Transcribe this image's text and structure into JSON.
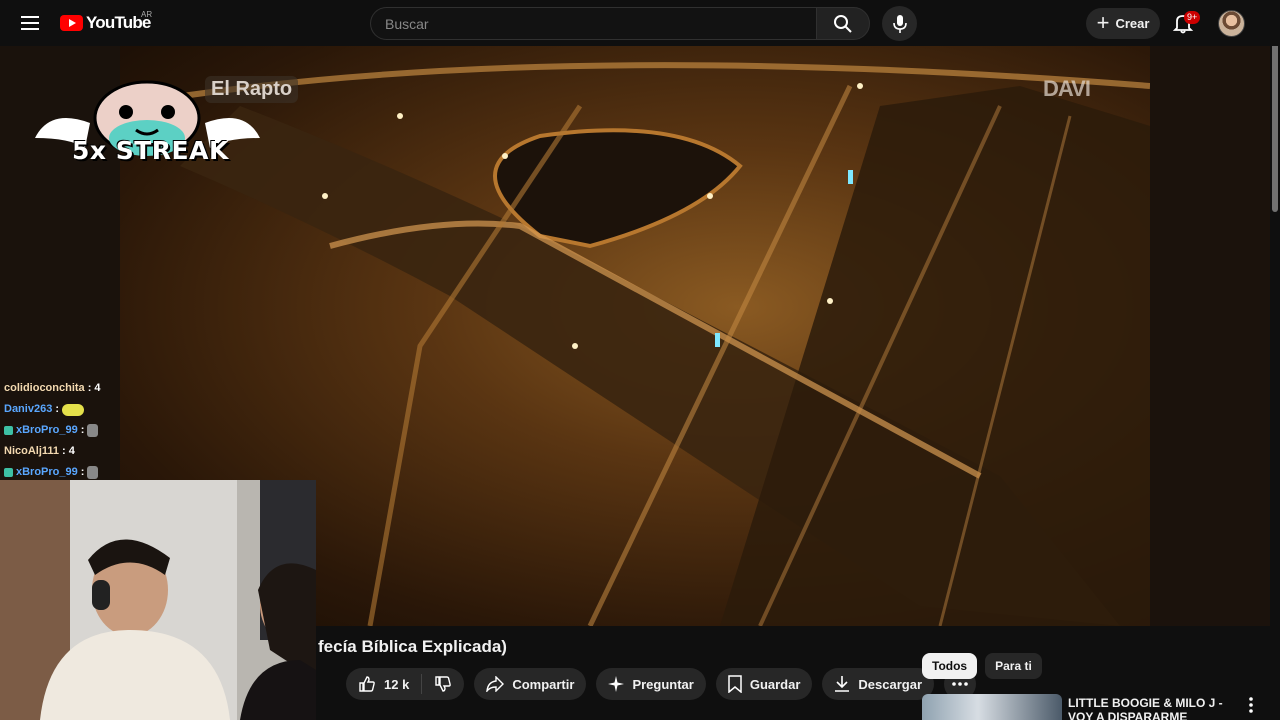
{
  "header": {
    "logo_text": "YouTube",
    "country_code": "AR",
    "search_placeholder": "Buscar",
    "create_label": "Crear",
    "notifications_badge": "9+"
  },
  "video": {
    "overlay_streak": "5x STREAK",
    "overlay_channel": "El Rapto",
    "watermark": "DAVI",
    "title": "fecía Bíblica Explicada)"
  },
  "chat": {
    "messages": [
      {
        "user": "colidioconchita",
        "text": "4"
      },
      {
        "user": "Daniv263",
        "text": ""
      },
      {
        "user": "xBroPro_99",
        "text": ""
      },
      {
        "user": "NicoAlj111",
        "text": "4"
      },
      {
        "user": "xBroPro_99",
        "text": ""
      }
    ]
  },
  "actions": {
    "likes": "12 k",
    "share": "Compartir",
    "ask": "Preguntar",
    "save": "Guardar",
    "download": "Descargar"
  },
  "chips": [
    "Todos",
    "Para ti"
  ],
  "recommended": {
    "title": "LITTLE BOOGIE & MILO J - VOY A DISPARARME (VIDEOCLIP"
  }
}
